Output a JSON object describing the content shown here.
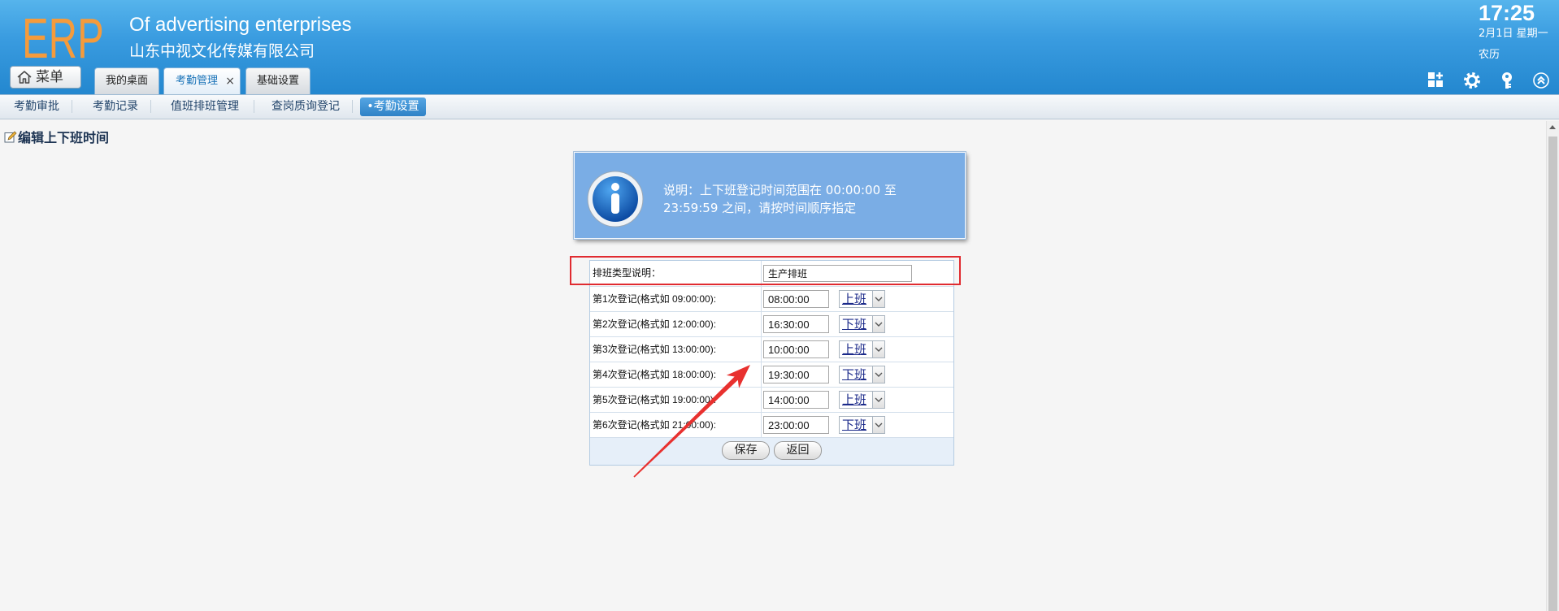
{
  "header": {
    "logo": "ERP",
    "title_en": "Of advertising enterprises",
    "title_cn": "山东中视文化传媒有限公司",
    "time": "17:25",
    "date": "2月1日 星期一",
    "lunar": "农历",
    "menu_label": "菜单",
    "tabs": [
      {
        "label": "我的桌面",
        "active": false
      },
      {
        "label": "考勤管理",
        "active": true,
        "close": "×"
      },
      {
        "label": "基础设置",
        "active": false
      }
    ],
    "icons": [
      "add-widget-icon",
      "gear-icon",
      "key-icon",
      "collapse-up-icon"
    ]
  },
  "subnav": {
    "items": [
      {
        "label": "考勤审批"
      },
      {
        "label": "考勤记录"
      },
      {
        "label": "值班排班管理"
      },
      {
        "label": "查岗质询登记"
      },
      {
        "label": "•考勤设置",
        "active": true
      }
    ]
  },
  "page": {
    "title": "编辑上下班时间"
  },
  "info": {
    "line1": "说明：上下班登记时间范围在 00:00:00 至",
    "line2": "23:59:59 之间，请按时间顺序指定"
  },
  "form": {
    "type_label": "排班类型说明：",
    "type_value": "生产排班",
    "rows": [
      {
        "label": "第1次登记(格式如 09:00:00):",
        "time": "08:00:00",
        "type": "上班"
      },
      {
        "label": "第2次登记(格式如 12:00:00):",
        "time": "16:30:00",
        "type": "下班"
      },
      {
        "label": "第3次登记(格式如 13:00:00):",
        "time": "10:00:00",
        "type": "上班"
      },
      {
        "label": "第4次登记(格式如 18:00:00):",
        "time": "19:30:00",
        "type": "下班"
      },
      {
        "label": "第5次登记(格式如 19:00:00):",
        "time": "14:00:00",
        "type": "上班"
      },
      {
        "label": "第6次登记(格式如 21:00:00):",
        "time": "23:00:00",
        "type": "下班"
      }
    ],
    "save_label": "保存",
    "back_label": "返回"
  },
  "colors": {
    "logo": "#f59b3c",
    "header_blue": "#2b8fd6",
    "active_tab_text": "#1a73b8",
    "info_bg": "#7aade5",
    "annotation_red": "#e02b30"
  }
}
